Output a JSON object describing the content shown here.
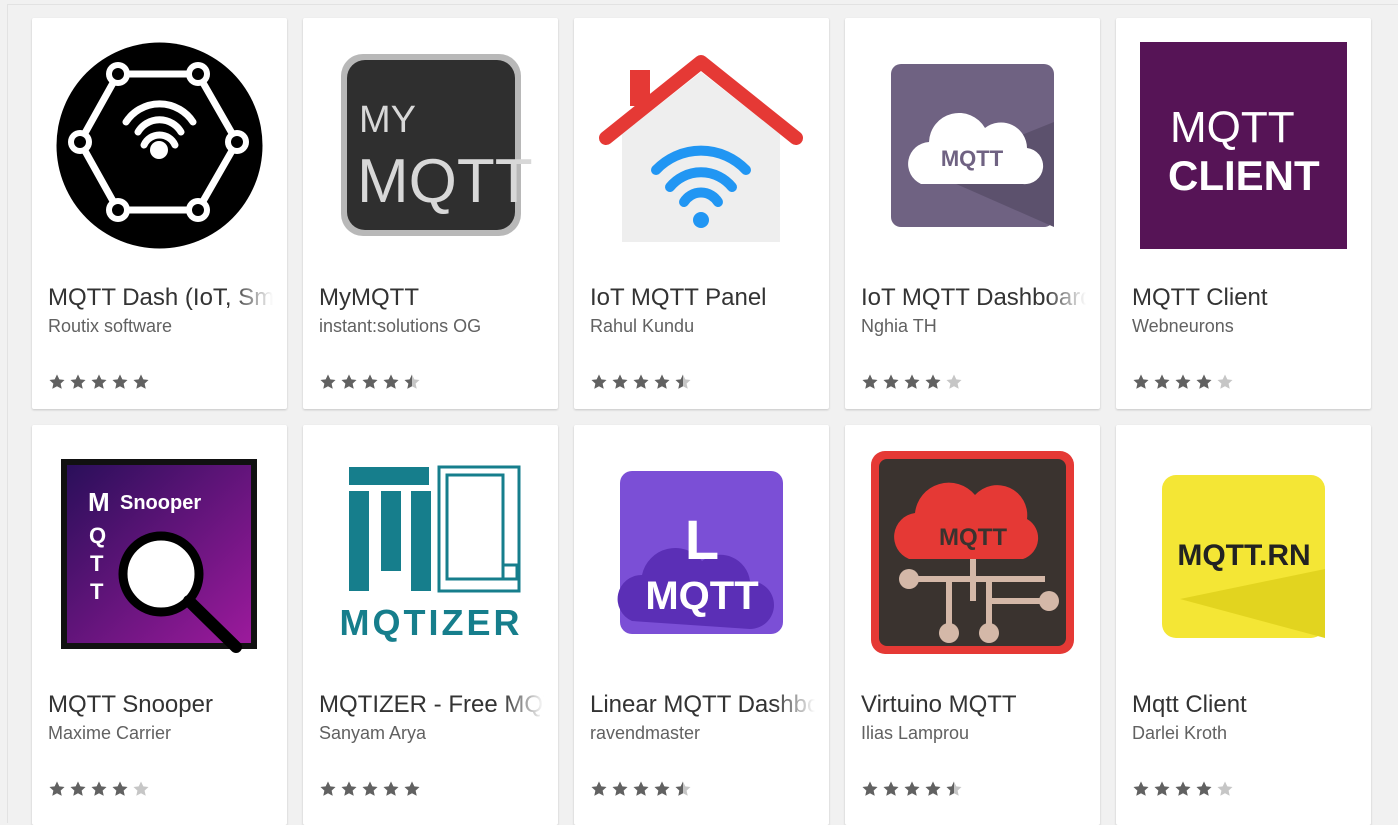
{
  "apps": [
    {
      "title": "MQTT Dash (IoT, Smart Home)",
      "developer": "Routix software",
      "rating": 5,
      "icon": "hexagon-antenna-icon"
    },
    {
      "title": "MyMQTT",
      "developer": "instant:solutions OG",
      "rating": 4.5,
      "icon": "mymqtt-text-icon",
      "icon_text": [
        "MY",
        "MQTT"
      ]
    },
    {
      "title": "IoT MQTT Panel",
      "developer": "Rahul Kundu",
      "rating": 4.5,
      "icon": "house-wifi-icon"
    },
    {
      "title": "IoT MQTT Dashboard",
      "developer": "Nghia TH",
      "rating": 4,
      "icon": "cloud-mqtt-icon",
      "icon_text": [
        "MQTT"
      ]
    },
    {
      "title": "MQTT Client",
      "developer": "Webneurons",
      "rating": 4,
      "icon": "mqtt-client-text-icon",
      "icon_text": [
        "MQTT",
        "CLIENT"
      ]
    },
    {
      "title": "MQTT Snooper",
      "developer": "Maxime Carrier",
      "rating": 4,
      "icon": "magnifier-snooper-icon",
      "icon_text": [
        "M",
        "Q",
        "T",
        "T",
        "Snooper"
      ]
    },
    {
      "title": "MQTIZER - Free MQTT Client",
      "developer": "Sanyam Arya",
      "rating": 5,
      "icon": "mqtizer-logo-icon",
      "icon_text": [
        "MQTIZER"
      ]
    },
    {
      "title": "Linear MQTT Dashboard",
      "developer": "ravendmaster",
      "rating": 4.5,
      "icon": "linear-cloud-icon",
      "icon_text": [
        "L",
        "MQTT"
      ]
    },
    {
      "title": "Virtuino MQTT",
      "developer": "Ilias Lamprou",
      "rating": 4.5,
      "icon": "cloud-network-icon",
      "icon_text": [
        "MQTT"
      ]
    },
    {
      "title": "Mqtt Client",
      "developer": "Darlei Kroth",
      "rating": 4,
      "icon": "mqtt-rn-icon",
      "icon_text": [
        "MQTT.RN"
      ]
    }
  ]
}
